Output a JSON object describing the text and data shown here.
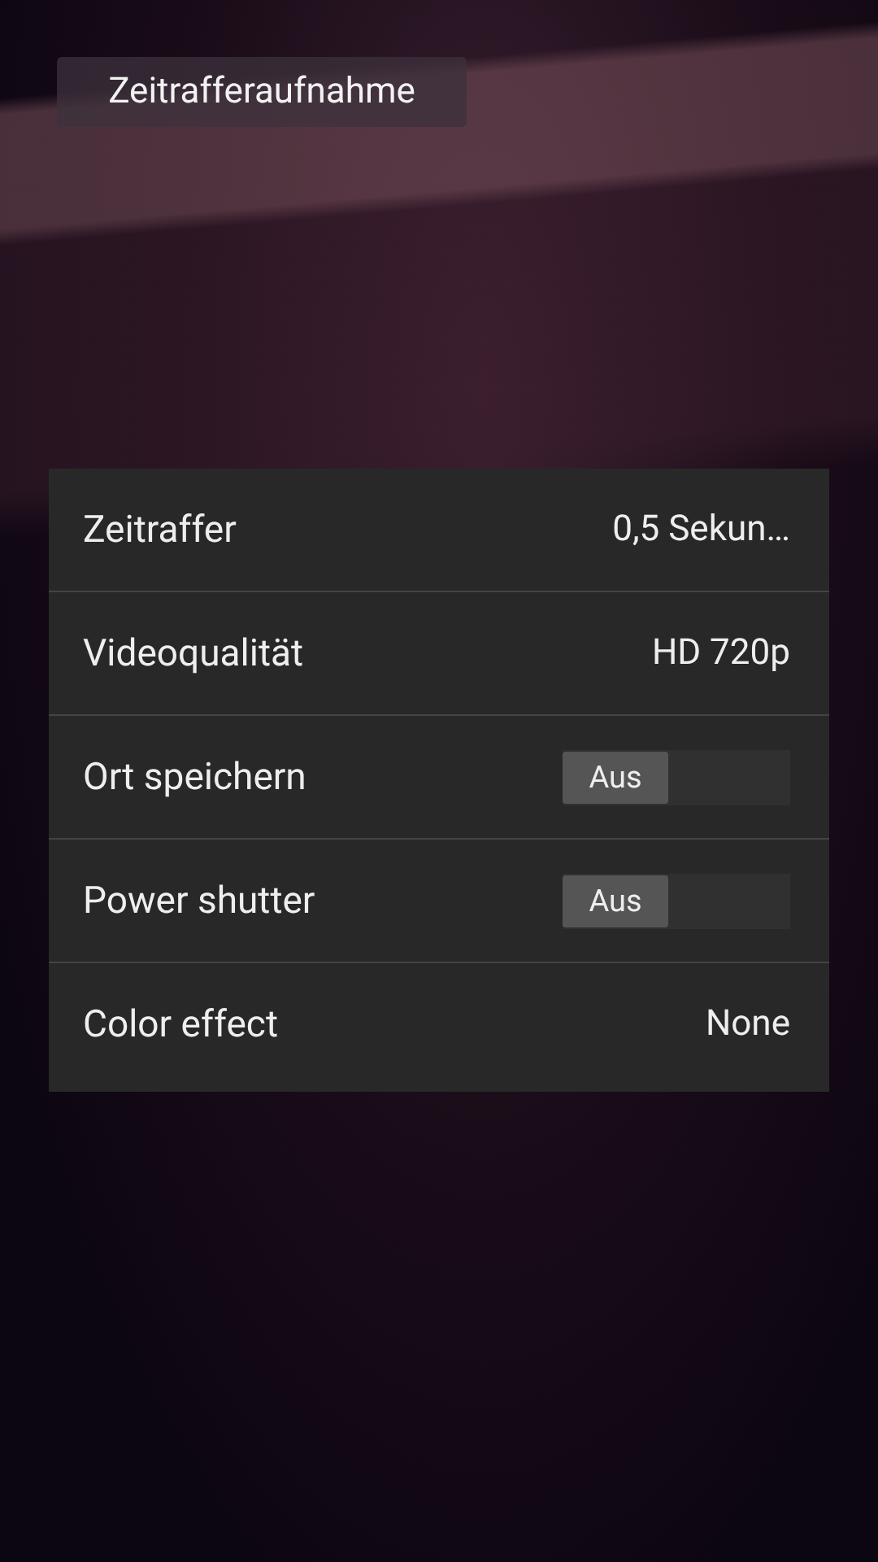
{
  "mode_label": "Zeitrafferaufnahme",
  "settings": [
    {
      "kind": "value",
      "label": "Zeitraffer",
      "value": "0,5 Sekun…"
    },
    {
      "kind": "value",
      "label": "Videoqualität",
      "value": "HD 720p"
    },
    {
      "kind": "switch",
      "label": "Ort speichern",
      "on": false,
      "state_text": "Aus"
    },
    {
      "kind": "switch",
      "label": "Power shutter",
      "on": false,
      "state_text": "Aus"
    },
    {
      "kind": "value",
      "label": "Color effect",
      "value": "None"
    }
  ]
}
